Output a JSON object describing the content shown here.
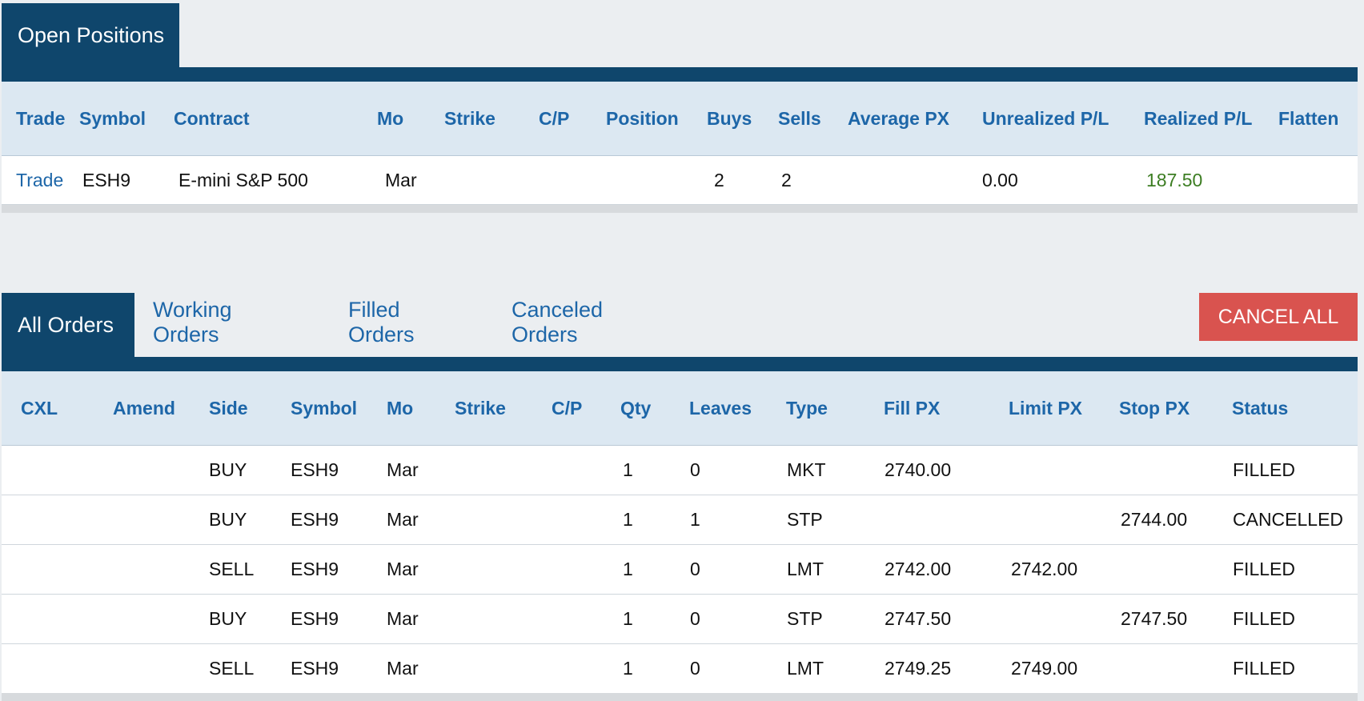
{
  "positions": {
    "tab_label": "Open Positions",
    "columns": [
      "Trade",
      "Symbol",
      "Contract",
      "Mo",
      "Strike",
      "C/P",
      "Position",
      "Buys",
      "Sells",
      "Average PX",
      "Unrealized P/L",
      "Realized P/L",
      "Flatten"
    ],
    "rows": [
      [
        "Trade",
        "ESH9",
        "E-mini S&P 500",
        "Mar",
        "",
        "",
        "",
        "2",
        "2",
        "",
        "0.00",
        "187.50",
        ""
      ]
    ]
  },
  "orders": {
    "tabs": [
      "All Orders",
      "Working Orders",
      "Filled Orders",
      "Canceled Orders"
    ],
    "active_tab": "All Orders",
    "cancel_all_label": "CANCEL ALL",
    "columns": [
      "CXL",
      "Amend",
      "Side",
      "Symbol",
      "Mo",
      "Strike",
      "C/P",
      "Qty",
      "Leaves",
      "Type",
      "Fill PX",
      "Limit PX",
      "Stop PX",
      "Status"
    ],
    "rows": [
      [
        "",
        "",
        "BUY",
        "ESH9",
        "Mar",
        "",
        "",
        "1",
        "0",
        "MKT",
        "2740.00",
        "",
        "",
        "FILLED"
      ],
      [
        "",
        "",
        "BUY",
        "ESH9",
        "Mar",
        "",
        "",
        "1",
        "1",
        "STP",
        "",
        "",
        "2744.00",
        "CANCELLED"
      ],
      [
        "",
        "",
        "SELL",
        "ESH9",
        "Mar",
        "",
        "",
        "1",
        "0",
        "LMT",
        "2742.00",
        "2742.00",
        "",
        "FILLED"
      ],
      [
        "",
        "",
        "BUY",
        "ESH9",
        "Mar",
        "",
        "",
        "1",
        "0",
        "STP",
        "2747.50",
        "",
        "2747.50",
        "FILLED"
      ],
      [
        "",
        "",
        "SELL",
        "ESH9",
        "Mar",
        "",
        "",
        "1",
        "0",
        "LMT",
        "2749.25",
        "2749.00",
        "",
        "FILLED"
      ]
    ]
  },
  "colors": {
    "navy": "#0f466c",
    "link_blue": "#1d66a8",
    "header_bg": "#dce8f2",
    "cancel_red": "#d9534f",
    "profit_green": "#3c7d22"
  }
}
